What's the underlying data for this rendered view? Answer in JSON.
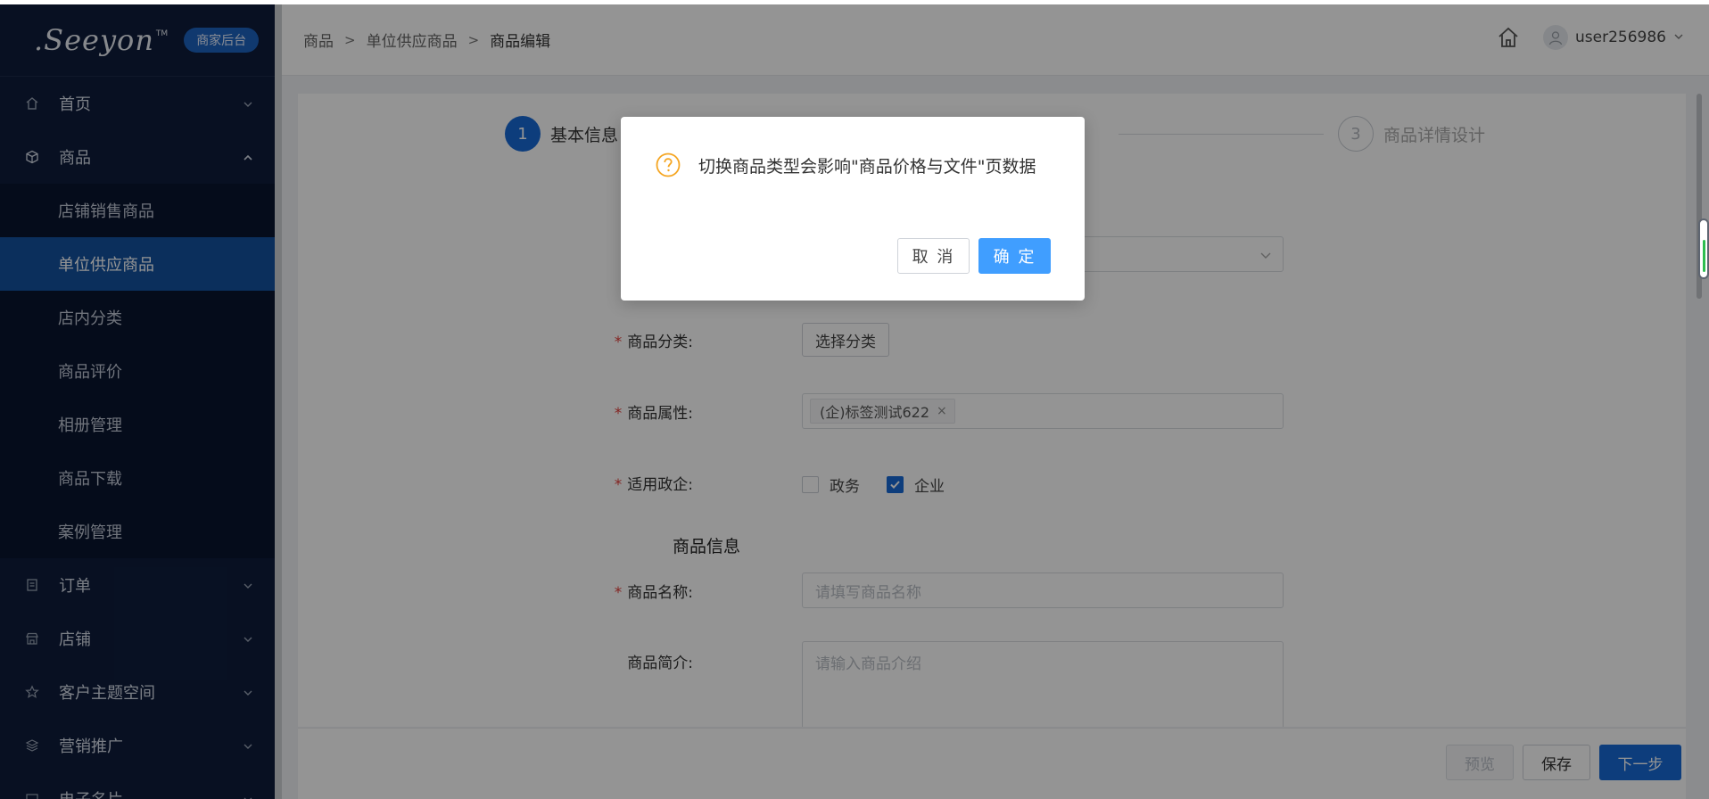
{
  "app": {
    "logo_text": ".Seeyon",
    "logo_tm": "TM",
    "logo_badge": "商家后台"
  },
  "sidebar": {
    "items": [
      {
        "label": "首页",
        "icon": "home-icon",
        "expanded": false
      },
      {
        "label": "商品",
        "icon": "cube-icon",
        "expanded": true
      },
      {
        "label": "订单",
        "icon": "order-icon",
        "expanded": false
      },
      {
        "label": "店铺",
        "icon": "shop-icon",
        "expanded": false
      },
      {
        "label": "客户主题空间",
        "icon": "star-icon",
        "expanded": false
      },
      {
        "label": "营销推广",
        "icon": "layers-icon",
        "expanded": false
      },
      {
        "label": "电子名片",
        "icon": "card-icon",
        "expanded": false
      }
    ],
    "sub_items": [
      {
        "label": "店铺销售商品"
      },
      {
        "label": "单位供应商品",
        "active": true
      },
      {
        "label": "店内分类"
      },
      {
        "label": "商品评价"
      },
      {
        "label": "相册管理"
      },
      {
        "label": "商品下载"
      },
      {
        "label": "案例管理"
      }
    ]
  },
  "header": {
    "breadcrumb": [
      "商品",
      "单位供应商品",
      "商品编辑"
    ],
    "breadcrumb_sep": ">",
    "username": "user256986"
  },
  "steps": [
    {
      "number": "1",
      "label": "基本信息",
      "active": true
    },
    {
      "number": "3",
      "label": "商品详情设计",
      "active": false
    }
  ],
  "form": {
    "category_label": "商品分类:",
    "category_button": "选择分类",
    "attribute_label": "商品属性:",
    "attribute_tag": "(企)标签测试622",
    "attribute_tag_close": "×",
    "scope_label": "适用政企:",
    "scope_options": [
      {
        "label": "政务",
        "checked": false
      },
      {
        "label": "企业",
        "checked": true
      }
    ],
    "section_title": "商品信息",
    "name_label": "商品名称:",
    "name_placeholder": "请填写商品名称",
    "intro_label": "商品简介:",
    "intro_placeholder": "请输入商品介绍",
    "required_mark": "*"
  },
  "footer": {
    "preview_label": "预览",
    "save_label": "保存",
    "next_label": "下一步"
  },
  "dialog": {
    "message": "切换商品类型会影响\"商品价格与文件\"页数据",
    "cancel_label": "取 消",
    "ok_label": "确 定"
  },
  "colors": {
    "sidebar_bg": "#0e1d3c",
    "active_menu": "#14519f",
    "primary": "#1769d6",
    "dialog_ok": "#409eff",
    "warning_icon": "#f5a623"
  }
}
